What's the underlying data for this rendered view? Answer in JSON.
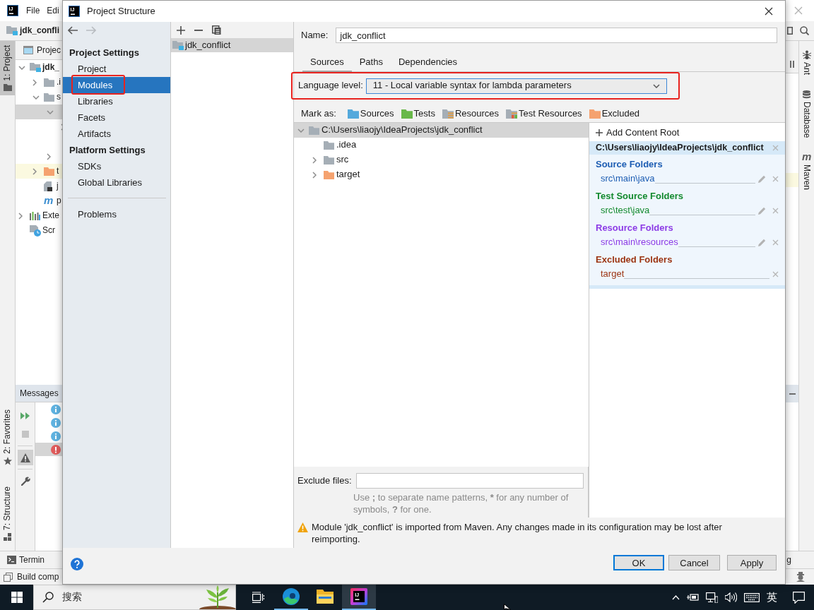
{
  "ide": {
    "logo_text": "IJ",
    "menu": [
      "File",
      "Edi"
    ],
    "breadcrumb": "jdk_confli",
    "left_stripe": [
      {
        "label": "1: Project",
        "kind": "project",
        "selected": true
      },
      {
        "label": "2: Favorites",
        "kind": "favorites",
        "selected": false
      },
      {
        "label": "7: Structure",
        "kind": "structure",
        "selected": false
      }
    ],
    "project_panel": {
      "title": "Projec",
      "tree": [
        {
          "label": "jdk_",
          "kind": "module",
          "expanded": true,
          "selected": false,
          "children": [
            {
              "label": ".i",
              "kind": "folder",
              "expanded": false,
              "selected": false
            },
            {
              "label": "s",
              "kind": "folder",
              "expanded": true,
              "selected": false,
              "children": [
                {
                  "expanded": true,
                  "selected": true,
                  "children": [
                    {
                      "expanded": false,
                      "selected": false
                    },
                    {
                      "selected": false
                    }
                  ]
                },
                {
                  "expanded": false,
                  "selected": false
                }
              ]
            },
            {
              "label": "t",
              "kind": "excluded-folder",
              "expanded": false,
              "selected": false
            },
            {
              "label": "j",
              "kind": "iml-file",
              "selected": false
            },
            {
              "label": "p",
              "kind": "maven-file",
              "icon_text": "m",
              "selected": false
            }
          ]
        },
        {
          "label": "Exte",
          "kind": "libraries",
          "expanded": false,
          "selected": false
        },
        {
          "label": "Scr",
          "kind": "scratches",
          "selected": false
        }
      ]
    },
    "messages": {
      "title": "Messages",
      "tools": [
        {
          "kind": "rerun",
          "disabled": false,
          "selected": false,
          "separator_after": false
        },
        {
          "kind": "stop",
          "disabled": true,
          "selected": false,
          "separator_after": true
        },
        {
          "kind": "warnings",
          "disabled": false,
          "selected": true,
          "separator_after": true
        },
        {
          "kind": "settings",
          "disabled": false,
          "selected": false,
          "separator_after": false
        }
      ],
      "rows": [
        {
          "kind": "info",
          "selected": false
        },
        {
          "kind": "info",
          "selected": false
        },
        {
          "kind": "info",
          "selected": false
        },
        {
          "kind": "error",
          "selected": true
        }
      ]
    },
    "right_stripe": [
      {
        "label": "Ant",
        "kind": "ant"
      },
      {
        "label": "Database",
        "kind": "database"
      },
      {
        "label": "Maven",
        "kind": "maven",
        "icon_text": "m"
      }
    ],
    "bottom_stripe": {
      "left": [
        {
          "label": "Termin",
          "kind": "terminal"
        }
      ],
      "right": [
        {
          "label": "g"
        }
      ]
    },
    "status_text": "Build comp"
  },
  "dialog": {
    "logo_text": "IJ",
    "title": "Project Structure",
    "nav": [
      {
        "kind": "back",
        "disabled": false
      },
      {
        "kind": "forward",
        "disabled": true
      }
    ],
    "sidebar": [
      {
        "title": "Project Settings",
        "items": [
          {
            "label": "Project",
            "selected": false,
            "highlighted": false
          },
          {
            "label": "Modules",
            "selected": true,
            "highlighted": true
          },
          {
            "label": "Libraries",
            "selected": false,
            "highlighted": false
          },
          {
            "label": "Facets",
            "selected": false,
            "highlighted": false
          },
          {
            "label": "Artifacts",
            "selected": false,
            "highlighted": false
          }
        ]
      },
      {
        "title": "Platform Settings",
        "items": [
          {
            "label": "SDKs",
            "selected": false,
            "highlighted": false
          },
          {
            "label": "Global Libraries",
            "selected": false,
            "highlighted": false
          }
        ]
      },
      {
        "items": [
          {
            "label": "Problems",
            "selected": false,
            "highlighted": false
          }
        ]
      }
    ],
    "module_tools": [
      {
        "kind": "add"
      },
      {
        "kind": "remove"
      },
      {
        "kind": "copy"
      }
    ],
    "modules": [
      {
        "label": "jdk_conflict",
        "selected": true
      }
    ],
    "name": {
      "label": "Name:",
      "value": "jdk_conflict"
    },
    "tabs": [
      {
        "label": "Sources",
        "selected": true
      },
      {
        "label": "Paths",
        "selected": false
      },
      {
        "label": "Dependencies",
        "selected": false
      }
    ],
    "language_level": {
      "label": "Language level:",
      "value": "11 - Local variable syntax for lambda parameters",
      "highlighted": true
    },
    "mark_as": {
      "label": "Mark as:",
      "buttons": [
        {
          "label": "Sources",
          "kind": "sources"
        },
        {
          "label": "Tests",
          "kind": "tests"
        },
        {
          "label": "Resources",
          "kind": "resources"
        },
        {
          "label": "Test Resources",
          "kind": "test-resources"
        },
        {
          "label": "Excluded",
          "kind": "excluded"
        }
      ]
    },
    "folder_tree": [
      {
        "label": "C:\\Users\\liaojy\\IdeaProjects\\jdk_conflict",
        "kind": "folder",
        "expanded": true,
        "selected": true,
        "children": [
          {
            "label": ".idea",
            "kind": "folder",
            "selected": false
          },
          {
            "label": "src",
            "kind": "folder",
            "expanded": false,
            "selected": false
          },
          {
            "label": "target",
            "kind": "excluded",
            "expanded": false,
            "selected": false
          }
        ]
      }
    ],
    "content_root": {
      "add_label": "Add Content Root",
      "path": "C:\\Users\\liaojy\\IdeaProjects\\jdk_conflict",
      "groups": [
        {
          "title": "Source Folders",
          "color": "#1d5db3",
          "folders": [
            {
              "path": "src\\main\\java",
              "editable": true
            }
          ]
        },
        {
          "title": "Test Source Folders",
          "color": "#138a2e",
          "folders": [
            {
              "path": "src\\test\\java",
              "editable": true
            }
          ]
        },
        {
          "title": "Resource Folders",
          "color": "#8c3be6",
          "folders": [
            {
              "path": "src\\main\\resources",
              "editable": true
            }
          ]
        },
        {
          "title": "Excluded Folders",
          "color": "#9c3513",
          "folders": [
            {
              "path": "target",
              "editable": false
            }
          ]
        }
      ]
    },
    "exclude_files": {
      "label": "Exclude files:",
      "hint": [
        {
          "text": "Use ",
          "bold": false
        },
        {
          "text": ";",
          "bold": true
        },
        {
          "text": " to separate name patterns, ",
          "bold": false
        },
        {
          "text": "*",
          "bold": true
        },
        {
          "text": " for any number of symbols, ",
          "bold": false
        },
        {
          "text": "?",
          "bold": true
        },
        {
          "text": " for one.",
          "bold": false
        }
      ]
    },
    "warning": "Module 'jdk_conflict' is imported from Maven. Any changes made in its configuration may be lost after reimporting.",
    "buttons": [
      {
        "label": "OK",
        "default": true
      },
      {
        "label": "Cancel",
        "default": false
      },
      {
        "label": "Apply",
        "default": false
      }
    ]
  },
  "taskbar": {
    "search_label": "搜索",
    "apps": [
      {
        "kind": "browser",
        "running": true,
        "selected": false
      },
      {
        "kind": "files",
        "running": false,
        "selected": false
      },
      {
        "kind": "ide",
        "logo_text": "IJ",
        "running": true,
        "selected": true
      }
    ],
    "tray": [
      {
        "kind": "chevron"
      },
      {
        "kind": "power"
      },
      {
        "kind": "network"
      },
      {
        "kind": "volume"
      },
      {
        "kind": "keyboard"
      },
      {
        "kind": "ime",
        "label": "英"
      },
      {
        "kind": "notifications"
      }
    ]
  }
}
